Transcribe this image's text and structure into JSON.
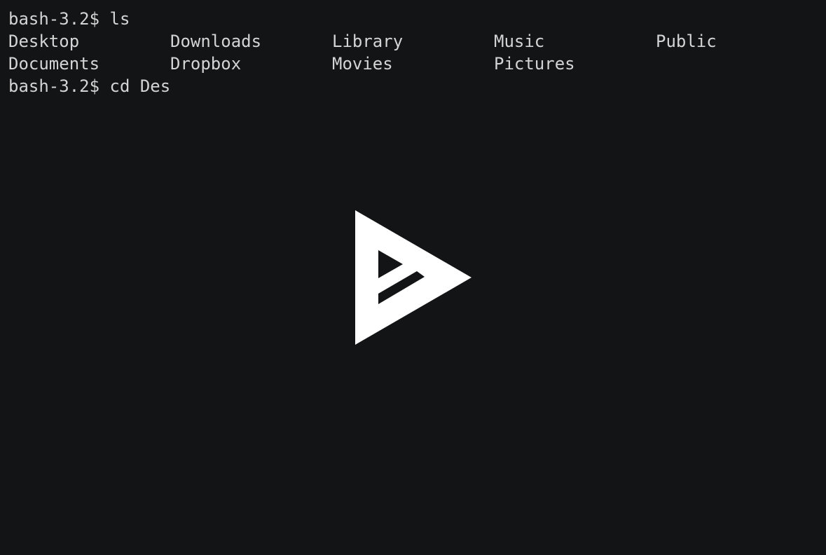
{
  "terminal": {
    "prompt": "bash-3.2$",
    "commands": [
      "ls",
      "cd Des"
    ],
    "ls_output": [
      [
        "Desktop",
        "Downloads",
        "Library",
        "Music",
        "Public"
      ],
      [
        "Documents",
        "Dropbox",
        "Movies",
        "Pictures"
      ]
    ],
    "colors": {
      "background": "#131416",
      "text": "#d4d4d4"
    }
  },
  "overlay": {
    "icon": "asciinema-play-logo",
    "color": "#ffffff"
  }
}
